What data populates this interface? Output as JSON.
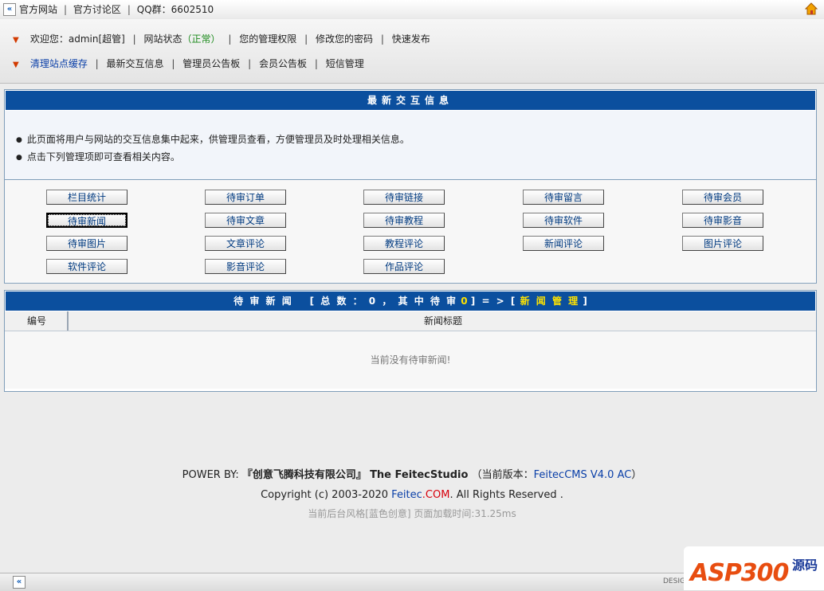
{
  "topbar": {
    "links": [
      "官方网站",
      "官方讨论区",
      "QQ群：6602510"
    ],
    "collapse_icon": "double-left-arrow",
    "home_icon": "home-icon"
  },
  "nav": {
    "row1": {
      "welcome_prefix": "欢迎您：",
      "username": "admin[超管]",
      "site_status_label": "网站状态",
      "site_status_value": "（正常）",
      "items": [
        "您的管理权限",
        "修改您的密码",
        "快速发布"
      ]
    },
    "row2": {
      "items": [
        "清理站点缓存",
        "最新交互信息",
        "管理员公告板",
        "会员公告板",
        "短信管理"
      ]
    }
  },
  "panel1": {
    "title": "最新交互信息",
    "intro": [
      "此页面将用户与网站的交互信息集中起来，供管理员查看，方便管理员及时处理相关信息。",
      "点击下列管理项即可查看相关内容。"
    ],
    "buttons": [
      "栏目统计",
      "待审订单",
      "待审链接",
      "待审留言",
      "待审会员",
      "待审新闻",
      "待审文章",
      "待审教程",
      "待审软件",
      "待审影音",
      "待审图片",
      "文章评论",
      "教程评论",
      "新闻评论",
      "图片评论",
      "软件评论",
      "影音评论",
      "作品评论"
    ]
  },
  "panel2": {
    "title_a": "待 审 新 闻",
    "title_b": "[ 总 数 ： 0 ， 其 中 待 审",
    "title_count": "0",
    "title_c": "] = > [",
    "title_link": "新 闻 管 理",
    "title_d": "]",
    "col_id": "编号",
    "col_title": "新闻标题",
    "empty_text": "当前没有待审新闻!"
  },
  "footer": {
    "powered_prefix": "POWER BY:",
    "company": "『创意飞腾科技有限公司』",
    "studio": "The FeitecStudio",
    "version_prefix": "（当前版本：",
    "version": "FeitecCMS V4.0 AC",
    "version_suffix": "）",
    "copyright_prefix": "Copyright (c) 2003-2020",
    "brand_a": "Feitec",
    "brand_b": ".COM",
    "copyright_suffix": ". All Rights Reserved .",
    "style_info": "当前后台风格[蓝色创意] 页面加载时间:31.25ms"
  },
  "bottombar": {
    "design_label": "DESIG"
  },
  "watermark": {
    "logo_text": "ASP300",
    "logo_cn": "源码"
  }
}
